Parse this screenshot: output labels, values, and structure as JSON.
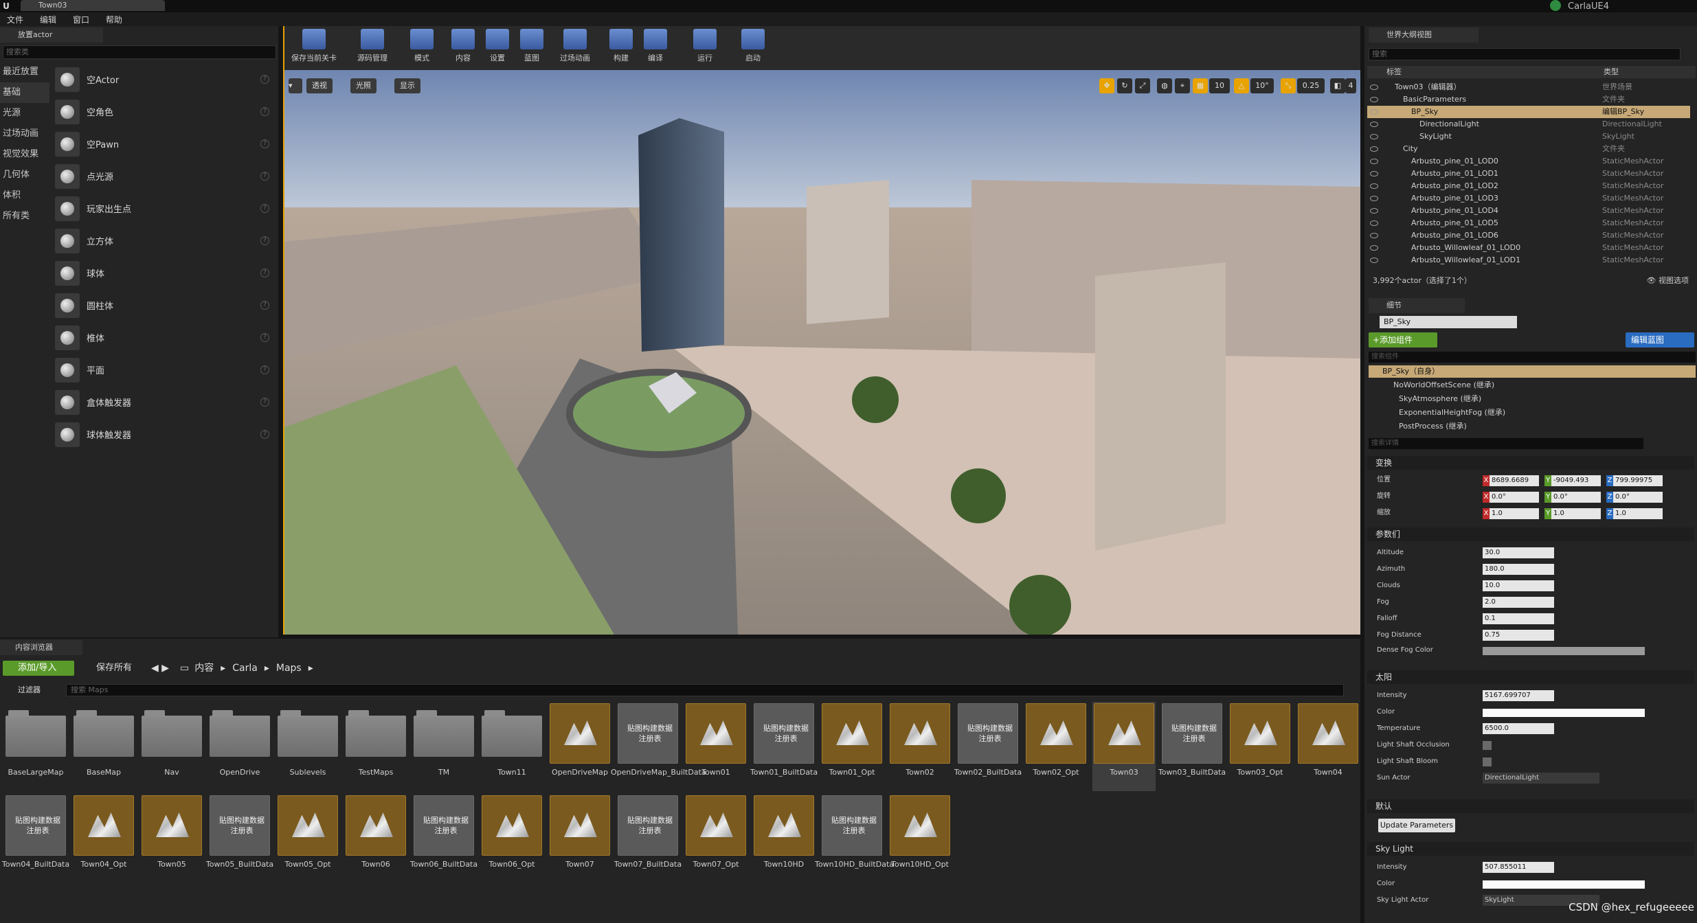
{
  "window": {
    "tab_title": "Town03",
    "app_name": "CarlaUE4"
  },
  "menu": [
    "文件",
    "编辑",
    "窗口",
    "帮助"
  ],
  "place_panel": {
    "tab": "放置actor",
    "search_placeholder": "搜索类",
    "categories": [
      "最近放置",
      "基础",
      "光源",
      "过场动画",
      "视觉效果",
      "几何体",
      "体积",
      "所有类"
    ],
    "active_category": "基础",
    "items": [
      "空Actor",
      "空角色",
      "空Pawn",
      "点光源",
      "玩家出生点",
      "立方体",
      "球体",
      "圆柱体",
      "椎体",
      "平面",
      "盒体触发器",
      "球体触发器"
    ]
  },
  "toolbar": {
    "buttons": [
      "保存当前关卡",
      "源码管理",
      "模式",
      "内容",
      "设置",
      "蓝图",
      "过场动画",
      "构建",
      "编译",
      "运行",
      "启动"
    ]
  },
  "viewport": {
    "left_buttons": [
      "透视",
      "光照",
      "显示"
    ],
    "snap_values": [
      "10",
      "10°",
      "0.25",
      "4"
    ]
  },
  "outliner": {
    "tab": "世界大纲视图",
    "search_placeholder": "搜索",
    "col_label": "标签",
    "col_type": "类型",
    "rows": [
      {
        "name": "Town03（编辑器）",
        "type": "世界场景",
        "indent": 0
      },
      {
        "name": "BasicParameters",
        "type": "文件夹",
        "indent": 1
      },
      {
        "name": "BP_Sky",
        "type": "编辑BP_Sky",
        "indent": 2,
        "selected": true
      },
      {
        "name": "DirectionalLight",
        "type": "DirectionalLight",
        "indent": 3
      },
      {
        "name": "SkyLight",
        "type": "SkyLight",
        "indent": 3
      },
      {
        "name": "City",
        "type": "文件夹",
        "indent": 1
      },
      {
        "name": "Arbusto_pine_01_LOD0",
        "type": "StaticMeshActor",
        "indent": 2
      },
      {
        "name": "Arbusto_pine_01_LOD1",
        "type": "StaticMeshActor",
        "indent": 2
      },
      {
        "name": "Arbusto_pine_01_LOD2",
        "type": "StaticMeshActor",
        "indent": 2
      },
      {
        "name": "Arbusto_pine_01_LOD3",
        "type": "StaticMeshActor",
        "indent": 2
      },
      {
        "name": "Arbusto_pine_01_LOD4",
        "type": "StaticMeshActor",
        "indent": 2
      },
      {
        "name": "Arbusto_pine_01_LOD5",
        "type": "StaticMeshActor",
        "indent": 2
      },
      {
        "name": "Arbusto_pine_01_LOD6",
        "type": "StaticMeshActor",
        "indent": 2
      },
      {
        "name": "Arbusto_Willowleaf_01_LOD0",
        "type": "StaticMeshActor",
        "indent": 2
      },
      {
        "name": "Arbusto_Willowleaf_01_LOD1",
        "type": "StaticMeshActor",
        "indent": 2
      }
    ],
    "status": "3,992个actor（选择了1个）",
    "view_options": "视图选项"
  },
  "details": {
    "tab": "细节",
    "name": "BP_Sky",
    "add_component": "+添加组件",
    "edit_blueprint": "编辑蓝图",
    "component_search": "搜索组件",
    "self_label": "BP_Sky（自身）",
    "components": [
      "NoWorldOffsetScene (继承)",
      "SkyAtmosphere (继承)",
      "ExponentialHeightFog (继承)",
      "PostProcess (继承)"
    ],
    "detail_search": "搜索详情",
    "transform": {
      "section": "变换",
      "location_label": "位置",
      "rotation_label": "旋转",
      "scale_label": "缩放",
      "location": [
        "8689.6689",
        "-9049.493",
        "799.99975"
      ],
      "rotation": [
        "0.0°",
        "0.0°",
        "0.0°"
      ],
      "scale": [
        "1.0",
        "1.0",
        "1.0"
      ]
    },
    "params_section": "参数们",
    "params": [
      {
        "label": "Altitude",
        "value": "30.0"
      },
      {
        "label": "Azimuth",
        "value": "180.0"
      },
      {
        "label": "Clouds",
        "value": "10.0"
      },
      {
        "label": "Fog",
        "value": "2.0"
      },
      {
        "label": "Falloff",
        "value": "0.1"
      },
      {
        "label": "Fog Distance",
        "value": "0.75"
      }
    ],
    "dense_fog_label": "Dense Fog Color",
    "sun_section": "太阳",
    "sun_intensity_label": "Intensity",
    "sun_intensity": "5167.699707",
    "sun_color_label": "Color",
    "temperature_label": "Temperature",
    "temperature": "6500.0",
    "light_shaft_occlusion": "Light Shaft Occlusion",
    "light_shaft_bloom": "Light Shaft Bloom",
    "sun_actor_label": "Sun Actor",
    "sun_actor": "DirectionalLight",
    "default_section": "默认",
    "update_button": "Update Parameters",
    "sky_section": "Sky Light",
    "sky_intensity_label": "Intensity",
    "sky_intensity": "507.855011",
    "sky_color_label": "Color",
    "sky_actor_label": "Sky Light Actor",
    "sky_actor": "SkyLight"
  },
  "content_browser": {
    "tab": "内容浏览器",
    "add_import": "添加/导入",
    "save_all": "保存所有",
    "path": [
      "内容",
      "Carla",
      "Maps"
    ],
    "filter": "过滤器",
    "search_placeholder": "搜索 Maps",
    "built_label_line1": "贴图构建数据",
    "built_label_line2": "注册表",
    "assets": [
      {
        "name": "BaseLargeMap",
        "kind": "folder"
      },
      {
        "name": "BaseMap",
        "kind": "folder"
      },
      {
        "name": "Nav",
        "kind": "folder"
      },
      {
        "name": "OpenDrive",
        "kind": "folder"
      },
      {
        "name": "Sublevels",
        "kind": "folder"
      },
      {
        "name": "TestMaps",
        "kind": "folder"
      },
      {
        "name": "TM",
        "kind": "folder"
      },
      {
        "name": "Town11",
        "kind": "folder"
      },
      {
        "name": "OpenDriveMap",
        "kind": "map"
      },
      {
        "name": "OpenDriveMap_BuiltData",
        "kind": "built"
      },
      {
        "name": "Town01",
        "kind": "map"
      },
      {
        "name": "Town01_BuiltData",
        "kind": "built"
      },
      {
        "name": "Town01_Opt",
        "kind": "map"
      },
      {
        "name": "Town02",
        "kind": "map"
      },
      {
        "name": "Town02_BuiltData",
        "kind": "built"
      },
      {
        "name": "Town02_Opt",
        "kind": "map"
      },
      {
        "name": "Town03",
        "kind": "map",
        "selected": true
      },
      {
        "name": "Town03_BuiltData",
        "kind": "built"
      },
      {
        "name": "Town03_Opt",
        "kind": "map"
      },
      {
        "name": "Town04",
        "kind": "map"
      },
      {
        "name": "Town04_BuiltData",
        "kind": "built"
      },
      {
        "name": "Town04_Opt",
        "kind": "map"
      },
      {
        "name": "Town05",
        "kind": "map"
      },
      {
        "name": "Town05_BuiltData",
        "kind": "built"
      },
      {
        "name": "Town05_Opt",
        "kind": "map"
      },
      {
        "name": "Town06",
        "kind": "map"
      },
      {
        "name": "Town06_BuiltData",
        "kind": "built"
      },
      {
        "name": "Town06_Opt",
        "kind": "map"
      },
      {
        "name": "Town07",
        "kind": "map"
      },
      {
        "name": "Town07_BuiltData",
        "kind": "built"
      },
      {
        "name": "Town07_Opt",
        "kind": "map"
      },
      {
        "name": "Town10HD",
        "kind": "map"
      },
      {
        "name": "Town10HD_BuiltData",
        "kind": "built"
      },
      {
        "name": "Town10HD_Opt",
        "kind": "map"
      }
    ]
  },
  "watermark": "CSDN @hex_refugeeeee"
}
